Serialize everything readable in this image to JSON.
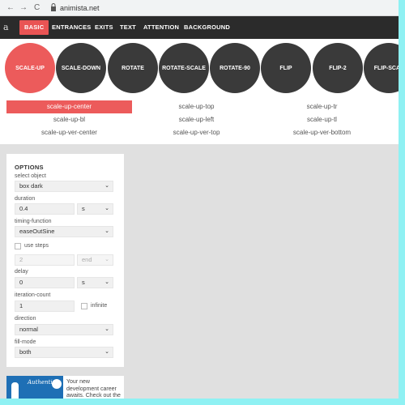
{
  "browser": {
    "url": "animista.net",
    "back_glyph": "←",
    "forward_glyph": "→",
    "reload_glyph": "C"
  },
  "header": {
    "logo": "a",
    "tabs": [
      {
        "label": "BASIC",
        "active": true
      },
      {
        "label": "ENTRANCES",
        "active": false
      },
      {
        "label": "EXITS",
        "active": false
      },
      {
        "label": "TEXT",
        "active": false
      },
      {
        "label": "ATTENTION",
        "active": false
      },
      {
        "label": "BACKGROUND",
        "active": false
      }
    ]
  },
  "animations": [
    {
      "label": "SCALE-UP",
      "active": true
    },
    {
      "label": "SCALE-DOWN",
      "active": false
    },
    {
      "label": "ROTATE",
      "active": false
    },
    {
      "label": "ROTATE-SCALE",
      "active": false
    },
    {
      "label": "ROTATE-90",
      "active": false
    },
    {
      "label": "FLIP",
      "active": false
    },
    {
      "label": "FLIP-2",
      "active": false
    },
    {
      "label": "FLIP-SCAL",
      "active": false
    }
  ],
  "variants": [
    {
      "label": "scale-up-center",
      "active": true
    },
    {
      "label": "scale-up-top",
      "active": false
    },
    {
      "label": "scale-up-tr",
      "active": false
    },
    {
      "label": "scale-up-bl",
      "active": false
    },
    {
      "label": "scale-up-left",
      "active": false
    },
    {
      "label": "scale-up-tl",
      "active": false
    },
    {
      "label": "scale-up-ver-center",
      "active": false
    },
    {
      "label": "scale-up-ver-top",
      "active": false
    },
    {
      "label": "scale-up-ver-bottom",
      "active": false
    }
  ],
  "options": {
    "title": "OPTIONS",
    "select_object_label": "select object",
    "select_object_value": "box dark",
    "duration_label": "duration",
    "duration_value": "0.4",
    "duration_unit": "s",
    "timing_label": "timing-function",
    "timing_value": "easeOutSine",
    "use_steps_label": "use steps",
    "steps_value": "2",
    "steps_mode": "end",
    "delay_label": "delay",
    "delay_value": "0",
    "delay_unit": "s",
    "iteration_label": "iteration-count",
    "iteration_value": "1",
    "infinite_label": "infinite",
    "direction_label": "direction",
    "direction_value": "normal",
    "fillmode_label": "fill-mode",
    "fillmode_value": "both",
    "chevron": "⌄"
  },
  "ad": {
    "brand": "Authentic",
    "text": "Your new development career awaits. Check out the latest listings."
  },
  "colors": {
    "accent": "#ec5b5b",
    "header_bg": "#2b2b2b",
    "circle_bg": "#3a3a3a",
    "page_bg": "#e0e0e0",
    "border": "#8ff1f3"
  }
}
